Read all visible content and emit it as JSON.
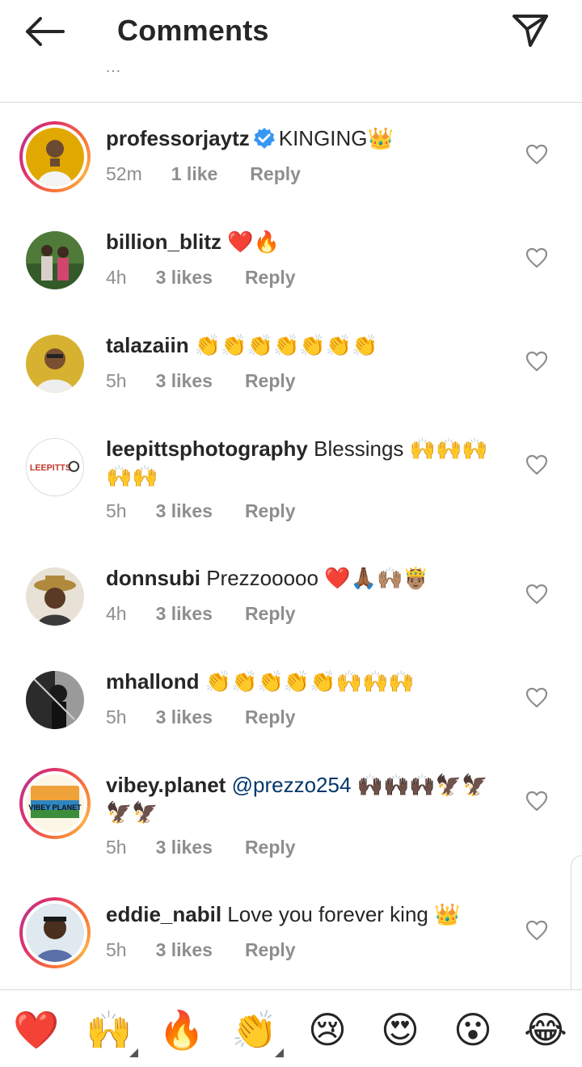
{
  "header": {
    "title": "Comments",
    "back_icon": "arrow-left-icon",
    "send_icon": "paper-plane-icon"
  },
  "comments": [
    {
      "username": "professorjaytz",
      "verified": true,
      "text": "KINGING👑",
      "time": "52m",
      "likes": "1 like",
      "reply": "Reply",
      "avatar": "avatar-photo",
      "story_ring": true
    },
    {
      "username": "billion_blitz",
      "verified": false,
      "text": "❤️🔥",
      "time": "4h",
      "likes": "3 likes",
      "reply": "Reply",
      "avatar": "avatar-photo",
      "story_ring": false
    },
    {
      "username": "talazaiin",
      "verified": false,
      "text": "👏👏👏👏👏👏👏",
      "time": "5h",
      "likes": "3 likes",
      "reply": "Reply",
      "avatar": "avatar-photo",
      "story_ring": false
    },
    {
      "username": "leepittsphotography",
      "verified": false,
      "text": "Blessings 🙌🙌🙌🙌🙌",
      "time": "5h",
      "likes": "3 likes",
      "reply": "Reply",
      "avatar": "logo-leepitts",
      "story_ring": false
    },
    {
      "username": "donnsubi",
      "verified": false,
      "text": "Prezzooooo ❤️🙏🏾🙌🏽🤴🏽",
      "time": "4h",
      "likes": "3 likes",
      "reply": "Reply",
      "avatar": "avatar-photo",
      "story_ring": false
    },
    {
      "username": "mhallond",
      "verified": false,
      "text": "👏👏👏👏👏🙌🙌🙌",
      "time": "5h",
      "likes": "3 likes",
      "reply": "Reply",
      "avatar": "avatar-photo",
      "story_ring": false
    },
    {
      "username": "vibey.planet",
      "verified": false,
      "mention": "@prezzo254",
      "text": "🙌🏿🙌🏿🙌🏿🦅🦅🦅🦅",
      "time": "5h",
      "likes": "3 likes",
      "reply": "Reply",
      "avatar": "logo-vibey-planet",
      "story_ring": true
    },
    {
      "username": "eddie_nabil",
      "verified": false,
      "text": "Love you forever king 👑",
      "time": "5h",
      "likes": "3 likes",
      "reply": "Reply",
      "avatar": "avatar-photo",
      "story_ring": true
    }
  ],
  "logos": {
    "leepitts": "LEEPITTS",
    "vibey": "VIBEY PLANET"
  },
  "quick_reactions": [
    "❤️",
    "🙌",
    "🔥",
    "👏",
    "😢",
    "😍",
    "😮",
    "😂"
  ],
  "colors": {
    "text": "#262626",
    "muted": "#8e8e8e",
    "mention": "#00376b",
    "verified": "#3897f0",
    "divider": "#dbdbdb"
  }
}
